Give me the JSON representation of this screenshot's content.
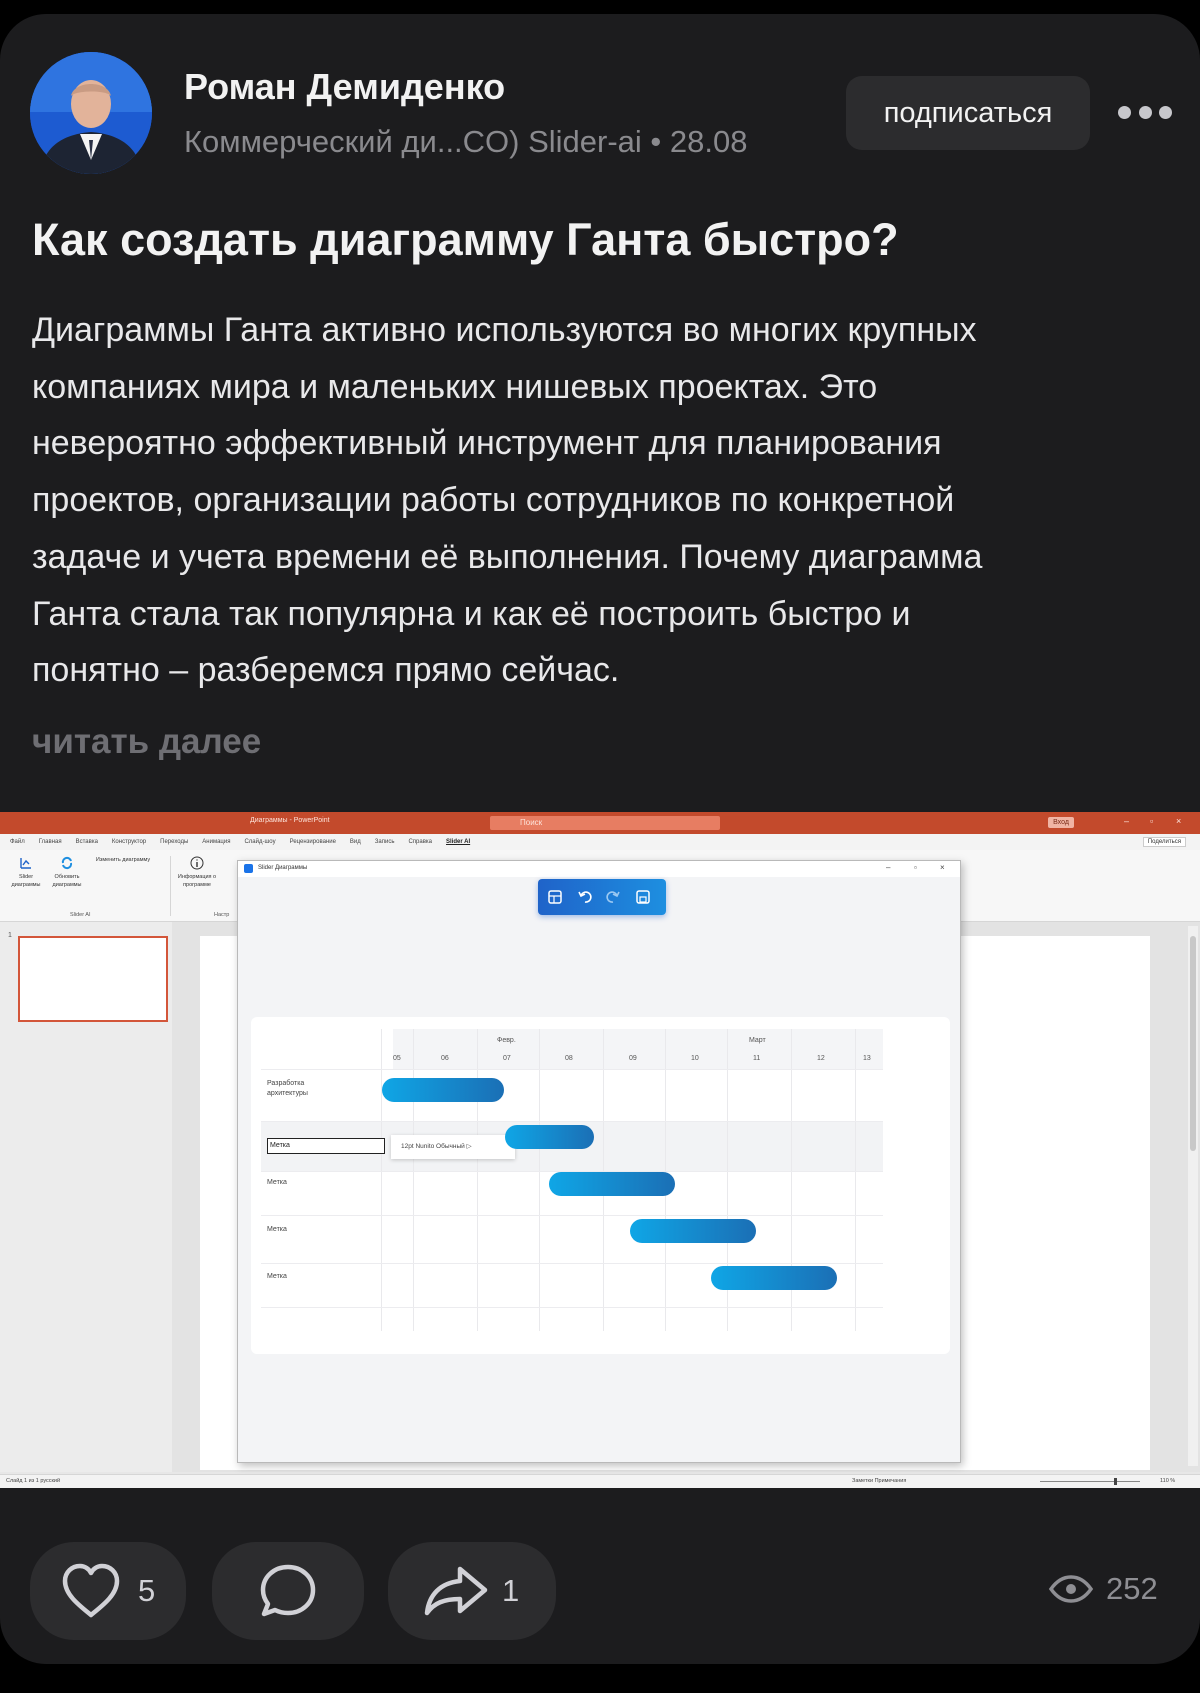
{
  "post": {
    "author": "Роман Демиденко",
    "meta": "Коммерческий ди...CO) Slider-ai • 28.08",
    "subscribe_label": "подписаться",
    "title": "Как создать диаграмму Ганта быстро?",
    "body_lines": [
      "Диаграммы Ганта активно используются во многих крупных",
      "компаниях мира и маленьких нишевых проектах. Это",
      "невероятно эффективный инструмент для планирования",
      "проектов, организации работы сотрудников по конкретной",
      "задаче и учета времени её выполнения. Почему диаграмма",
      "Ганта стала так популярна и как её построить быстро и",
      "понятно – разберемся прямо сейчас."
    ],
    "read_more": "читать далее"
  },
  "screenshot": {
    "window_title": "Диаграммы - PowerPoint",
    "search_placeholder": "Поиск",
    "sign_in": "Вход",
    "menu": [
      "Файл",
      "Главная",
      "Вставка",
      "Конструктор",
      "Переходы",
      "Анимация",
      "Слайд-шоу",
      "Рецензирование",
      "Вид",
      "Запись",
      "Справка",
      "Slider AI"
    ],
    "menu_active": "Slider AI",
    "share": "Поделиться",
    "ribbon": {
      "btn1": "Slider диаграммы",
      "btn2": "Обновить диаграммы",
      "btn3": "Изменить диаграмму",
      "btn4": "Информация о программе",
      "group1": "Slider AI",
      "group2": "Настр"
    },
    "slide_number": "1",
    "status_left": "Слайд 1 из 1    русский",
    "status_right": "Заметки   Примечания",
    "zoom": "110 %",
    "dialog_title": "Slider Диаграммы",
    "gantt": {
      "months": [
        "Февр.",
        "Март"
      ],
      "days": [
        "05",
        "06",
        "07",
        "08",
        "09",
        "10",
        "11",
        "12",
        "13"
      ],
      "rows": [
        "Разработка архитектуры",
        "Метка",
        "Метка",
        "Метка",
        "Метка"
      ],
      "editing_value": "Метка",
      "font_popup": "12pt Nunito Обычный ▷"
    }
  },
  "actions": {
    "likes": "5",
    "reposts": "1",
    "views": "252"
  },
  "colors": {
    "card_bg": "#1c1c1e",
    "pill_bg": "#2c2c2e",
    "powerpoint_accent": "#c34a2c",
    "gantt_bar": "#0fa6e6"
  }
}
